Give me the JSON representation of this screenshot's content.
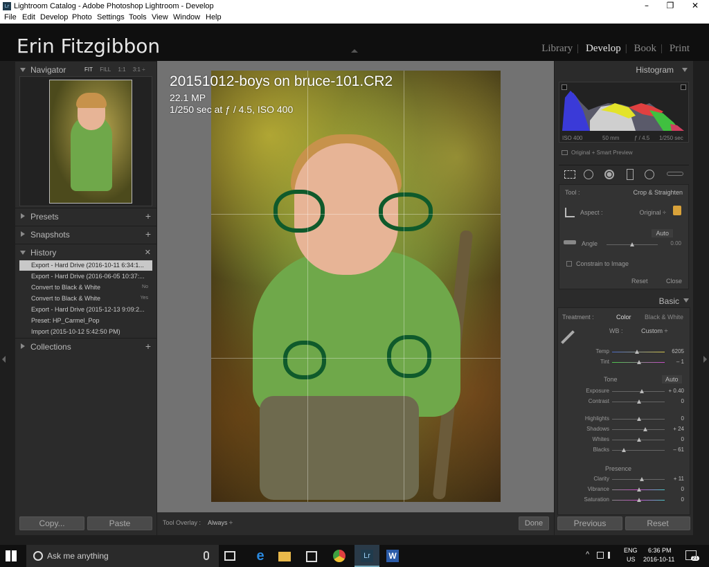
{
  "window": {
    "title": "Lightroom Catalog - Adobe Photoshop Lightroom - Develop",
    "logo": "Lr",
    "minimize": "–",
    "maximize": "❐",
    "close": "✕"
  },
  "menu": [
    "File",
    "Edit",
    "Develop",
    "Photo",
    "Settings",
    "Tools",
    "View",
    "Window",
    "Help"
  ],
  "identity": "Erin Fitzgibbon",
  "modules": {
    "library": "Library",
    "develop": "Develop",
    "book": "Book",
    "print": "Print",
    "sep": "|"
  },
  "navigator": {
    "title": "Navigator",
    "fit": "FIT",
    "fill": "FILL",
    "one": "1:1",
    "three": "3:1 ÷"
  },
  "left_panels": {
    "presets": "Presets",
    "snapshots": "Snapshots",
    "history": "History",
    "collections": "Collections"
  },
  "history": [
    {
      "label": "Export - Hard Drive (2016-10-11 6:34:1...",
      "value": ""
    },
    {
      "label": "Export - Hard Drive (2016-06-05 10:37:...",
      "value": ""
    },
    {
      "label": "Convert to Black & White",
      "value": "No"
    },
    {
      "label": "Convert to Black & White",
      "value": "Yes"
    },
    {
      "label": "Export - Hard Drive (2015-12-13 9:09:2...",
      "value": ""
    },
    {
      "label": "Preset: HP_Carmel_Pop",
      "value": ""
    },
    {
      "label": "Import (2015-10-12 5:42:50 PM)",
      "value": ""
    }
  ],
  "left_buttons": {
    "copy": "Copy...",
    "paste": "Paste"
  },
  "photo_info": {
    "filename": "20151012-boys on bruce-101.CR2",
    "mp": "22.1 MP",
    "exposure": "1/250 sec at ƒ / 4.5, ISO 400"
  },
  "toolbar": {
    "overlay_label": "Tool Overlay :",
    "overlay_value": "Always ÷",
    "done": "Done"
  },
  "histogram": {
    "title": "Histogram",
    "iso": "ISO 400",
    "focal": "50 mm",
    "aperture": "ƒ / 4.5",
    "shutter": "1/250 sec",
    "preview": "Original + Smart Preview"
  },
  "crop": {
    "tool_label": "Tool :",
    "tool_value": "Crop & Straighten",
    "aspect_label": "Aspect :",
    "aspect_value": "Original ÷",
    "auto": "Auto",
    "angle_label": "Angle",
    "angle_value": "0.00",
    "constrain": "Constrain to Image",
    "reset": "Reset",
    "close": "Close"
  },
  "basic": {
    "title": "Basic",
    "treatment_label": "Treatment :",
    "color": "Color",
    "bw": "Black & White",
    "wb_label": "WB :",
    "wb_value": "Custom ÷",
    "temp_label": "Temp",
    "temp_value": "6205",
    "tint_label": "Tint",
    "tint_value": "– 1",
    "tone": "Tone",
    "tone_auto": "Auto",
    "exposure_label": "Exposure",
    "exposure_value": "+ 0.40",
    "contrast_label": "Contrast",
    "contrast_value": "0",
    "highlights_label": "Highlights",
    "highlights_value": "0",
    "shadows_label": "Shadows",
    "shadows_value": "+ 24",
    "whites_label": "Whites",
    "whites_value": "0",
    "blacks_label": "Blacks",
    "blacks_value": "– 61",
    "presence": "Presence",
    "clarity_label": "Clarity",
    "clarity_value": "+ 11",
    "vibrance_label": "Vibrance",
    "vibrance_value": "0",
    "saturation_label": "Saturation",
    "saturation_value": "0"
  },
  "right_buttons": {
    "previous": "Previous",
    "reset": "Reset"
  },
  "taskbar": {
    "search": "Ask me anything",
    "lang1": "ENG",
    "lang2": "US",
    "time": "6:36 PM",
    "date": "2016-10-11",
    "notif": "21",
    "lr": "Lr",
    "word": "W"
  }
}
